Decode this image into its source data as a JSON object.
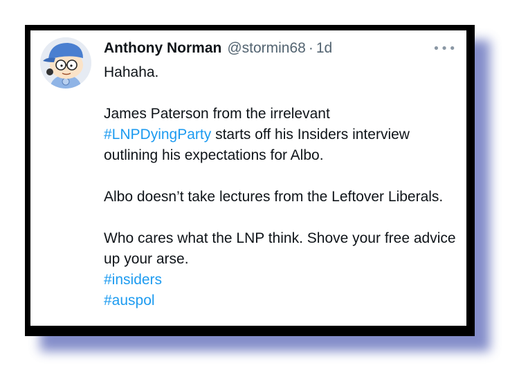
{
  "tweet": {
    "author_name": "Anthony Norman",
    "handle": "@stormin68",
    "separator": "·",
    "time": "1d",
    "more_icon": "more-dots-icon",
    "avatar_icon": "cartoon-avatar-icon",
    "line1": "Hahaha.",
    "p2_text1": "James Paterson from the irrelevant",
    "p2_hashtag": "#LNPDyingParty",
    "p2_text2": " starts off his Insiders interview outlining his expectations for Albo.",
    "p3": "Albo doesn’t take lectures from the Leftover Liberals.",
    "p4": "Who cares what the LNP think. Shove your free advice up your arse.",
    "hashtag1": "#insiders",
    "hashtag2": "#auspol"
  },
  "colors": {
    "frame": "#000000",
    "shadow": "#5a67b8",
    "hashtag": "#1d9bf0",
    "text": "#0f1419",
    "secondary": "#536471"
  }
}
